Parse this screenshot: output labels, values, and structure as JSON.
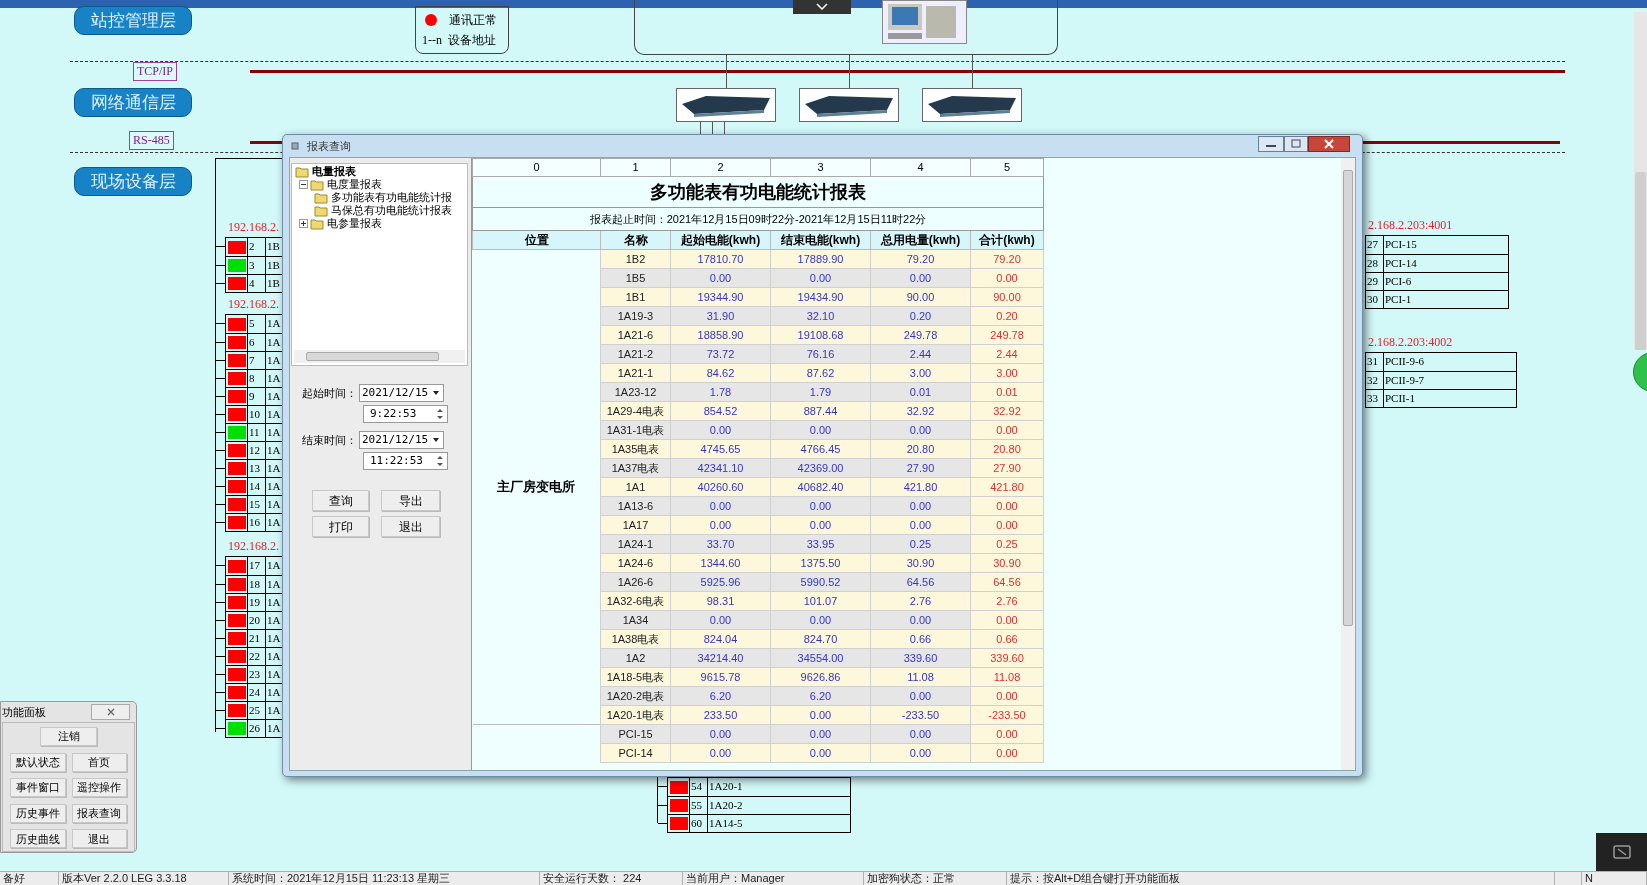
{
  "layers": [
    {
      "label": "站控管理层"
    },
    {
      "label": "网络通信层"
    },
    {
      "label": "现场设备层"
    }
  ],
  "legend": [
    {
      "kind": "dot",
      "label": "通讯正常"
    },
    {
      "kind": "symbol",
      "symbol": "1--n",
      "label": "设备地址"
    }
  ],
  "protocols": [
    "TCP/IP",
    "RS-485"
  ],
  "device_groups": [
    {
      "address": "192.168.2.",
      "rows": [
        {
          "number": "2",
          "name": "1B",
          "online": false
        },
        {
          "number": "3",
          "name": "1B",
          "online": true
        },
        {
          "number": "4",
          "name": "1B",
          "online": false
        }
      ]
    },
    {
      "address": "192.168.2.",
      "rows": [
        {
          "number": "5",
          "name": "1A",
          "online": false
        },
        {
          "number": "6",
          "name": "1A",
          "online": false
        },
        {
          "number": "7",
          "name": "1A",
          "online": false
        },
        {
          "number": "8",
          "name": "1A",
          "online": false
        },
        {
          "number": "9",
          "name": "1A",
          "online": false
        },
        {
          "number": "10",
          "name": "1A",
          "online": false
        },
        {
          "number": "11",
          "name": "1A",
          "online": true
        },
        {
          "number": "12",
          "name": "1A",
          "online": false
        },
        {
          "number": "13",
          "name": "1A",
          "online": false
        },
        {
          "number": "14",
          "name": "1A",
          "online": false
        },
        {
          "number": "15",
          "name": "1A",
          "online": false
        },
        {
          "number": "16",
          "name": "1A",
          "online": false
        }
      ]
    },
    {
      "address": "192.168.2.",
      "rows": [
        {
          "number": "17",
          "name": "1A",
          "online": false
        },
        {
          "number": "18",
          "name": "1A",
          "online": false
        },
        {
          "number": "19",
          "name": "1A",
          "online": false
        },
        {
          "number": "20",
          "name": "1A",
          "online": false
        },
        {
          "number": "21",
          "name": "1A",
          "online": false
        },
        {
          "number": "22",
          "name": "1A",
          "online": false
        },
        {
          "number": "23",
          "name": "1A",
          "online": false
        },
        {
          "number": "24",
          "name": "1A",
          "online": false
        },
        {
          "number": "25",
          "name": "1A",
          "online": false
        },
        {
          "number": "26",
          "name": "1A",
          "online": true
        }
      ]
    },
    {
      "address": "2.168.2.203:4001",
      "rows": [
        {
          "number": "27",
          "name": "PCI-15"
        },
        {
          "number": "28",
          "name": "PCI-14"
        },
        {
          "number": "29",
          "name": "PCI-6"
        },
        {
          "number": "30",
          "name": "PCI-1"
        }
      ]
    },
    {
      "address": "2.168.2.203:4002",
      "rows": [
        {
          "number": "31",
          "name": "PCII-9-6"
        },
        {
          "number": "32",
          "name": "PCII-9-7"
        },
        {
          "number": "33",
          "name": "PCII-1"
        }
      ]
    },
    {
      "rows": [
        {
          "number": "54",
          "name": "1A20-1",
          "online": false
        },
        {
          "number": "55",
          "name": "1A20-2",
          "online": false
        },
        {
          "number": "60",
          "name": "1A14-5",
          "online": false
        }
      ]
    }
  ],
  "report_dialog": {
    "title": "报表查询",
    "tree": [
      {
        "label": "电量报表",
        "children": [
          {
            "label": "电度量报表",
            "expanded": true,
            "children": [
              {
                "label": "多功能表有功电能统计报"
              },
              {
                "label": "马保总有功电能统计报表"
              }
            ]
          },
          {
            "label": "电参量报表",
            "expanded": false
          }
        ]
      }
    ],
    "start_label": "起始时间：",
    "start_date": "2021/12/15",
    "start_time": "9:22:53",
    "end_label": "结束时间：",
    "end_date": "2021/12/15",
    "end_time": "11:22:53",
    "buttons": [
      "查询",
      "导出",
      "打印",
      "退出"
    ],
    "table": {
      "column_numbers": [
        "0",
        "1",
        "2",
        "3",
        "4",
        "5"
      ],
      "title": "多功能表有功电能统计报表",
      "period": "报表起止时间：2021年12月15日09时22分-2021年12月15日11时22分",
      "columns": [
        "位置",
        "名称",
        "起始电能(kwh)",
        "结束电能(kwh)",
        "总用电量(kwh)",
        "合计(kwh)"
      ],
      "groups": [
        {
          "location": "主厂房变电所",
          "rows": [
            [
              "1B2",
              "17810.70",
              "17889.90",
              "79.20",
              "79.20"
            ],
            [
              "1B5",
              "0.00",
              "0.00",
              "0.00",
              "0.00"
            ],
            [
              "1B1",
              "19344.90",
              "19434.90",
              "90.00",
              "90.00"
            ],
            [
              "1A19-3",
              "31.90",
              "32.10",
              "0.20",
              "0.20"
            ],
            [
              "1A21-6",
              "18858.90",
              "19108.68",
              "249.78",
              "249.78"
            ],
            [
              "1A21-2",
              "73.72",
              "76.16",
              "2.44",
              "2.44"
            ],
            [
              "1A21-1",
              "84.62",
              "87.62",
              "3.00",
              "3.00"
            ],
            [
              "1A23-12",
              "1.78",
              "1.79",
              "0.01",
              "0.01"
            ],
            [
              "1A29-4电表",
              "854.52",
              "887.44",
              "32.92",
              "32.92"
            ],
            [
              "1A31-1电表",
              "0.00",
              "0.00",
              "0.00",
              "0.00"
            ],
            [
              "1A35电表",
              "4745.65",
              "4766.45",
              "20.80",
              "20.80"
            ],
            [
              "1A37电表",
              "42341.10",
              "42369.00",
              "27.90",
              "27.90"
            ],
            [
              "1A1",
              "40260.60",
              "40682.40",
              "421.80",
              "421.80"
            ],
            [
              "1A13-6",
              "0.00",
              "0.00",
              "0.00",
              "0.00"
            ],
            [
              "1A17",
              "0.00",
              "0.00",
              "0.00",
              "0.00"
            ],
            [
              "1A24-1",
              "33.70",
              "33.95",
              "0.25",
              "0.25"
            ],
            [
              "1A24-6",
              "1344.60",
              "1375.50",
              "30.90",
              "30.90"
            ],
            [
              "1A26-6",
              "5925.96",
              "5990.52",
              "64.56",
              "64.56"
            ],
            [
              "1A32-6电表",
              "98.31",
              "101.07",
              "2.76",
              "2.76"
            ],
            [
              "1A34",
              "0.00",
              "0.00",
              "0.00",
              "0.00"
            ],
            [
              "1A38电表",
              "824.04",
              "824.70",
              "0.66",
              "0.66"
            ],
            [
              "1A2",
              "34214.40",
              "34554.00",
              "339.60",
              "339.60"
            ],
            [
              "1A18-5电表",
              "9615.78",
              "9626.86",
              "11.08",
              "11.08"
            ],
            [
              "1A20-2电表",
              "6.20",
              "6.20",
              "0.00",
              "0.00"
            ],
            [
              "1A20-1电表",
              "233.50",
              "0.00",
              "-233.50",
              "-233.50"
            ]
          ]
        },
        {
          "rows": [
            [
              "PCI-15",
              "0.00",
              "0.00",
              "0.00",
              "0.00"
            ],
            [
              "PCI-14",
              "0.00",
              "0.00",
              "0.00",
              "0.00"
            ]
          ]
        }
      ]
    }
  },
  "function_panel": {
    "title": "功能面板",
    "buttons": [
      "注销",
      "默认状态",
      "首页",
      "事件窗口",
      "遥控操作",
      "历史事件",
      "报表查询",
      "历史曲线",
      "退出"
    ]
  },
  "status_bar": [
    "备好",
    "版本Ver 2.2.0 LEG 3.3.18",
    "系统时间：2021年12月15日  11:23:13   星期三",
    "安全运行天数： 224",
    "当前用户：Manager",
    "加密狗状态：正常",
    "提示：按Alt+D组合键打开功能面板",
    "N"
  ]
}
